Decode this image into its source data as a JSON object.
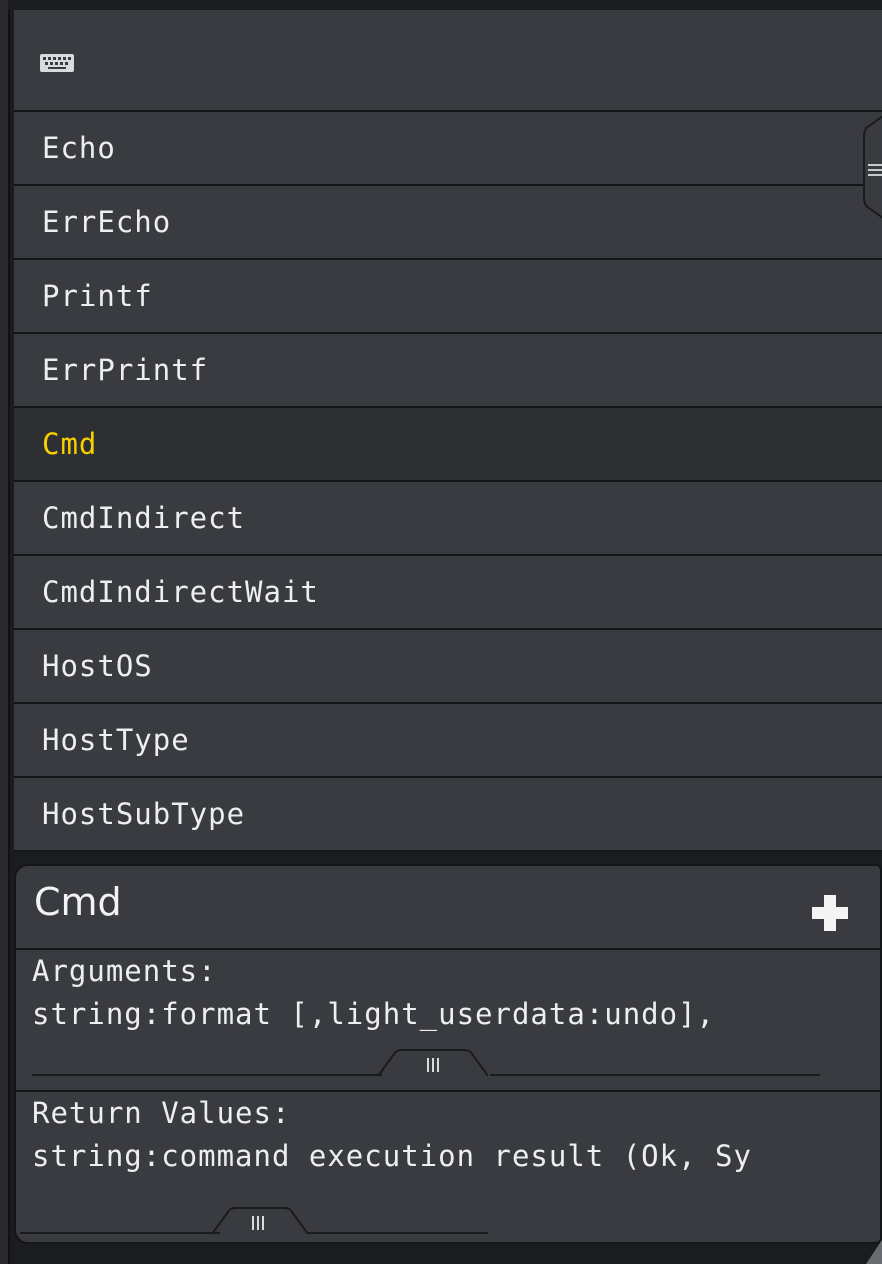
{
  "toolbar": {
    "icon": "keyboard-icon"
  },
  "list": {
    "items": [
      {
        "label": "Echo"
      },
      {
        "label": "ErrEcho"
      },
      {
        "label": "Printf"
      },
      {
        "label": "ErrPrintf"
      },
      {
        "label": "Cmd",
        "selected": true
      },
      {
        "label": "CmdIndirect"
      },
      {
        "label": "CmdIndirectWait"
      },
      {
        "label": "HostOS"
      },
      {
        "label": "HostType"
      },
      {
        "label": "HostSubType"
      }
    ]
  },
  "detail": {
    "title": "Cmd",
    "add_icon": "plus-icon",
    "arguments_heading": "Arguments:",
    "arguments_value": "string:format [,light_userdata:undo],",
    "returns_heading": "Return Values:",
    "returns_value": "string:command execution result (Ok, Sy"
  },
  "colors": {
    "panel": "#3a3b40",
    "selected_text": "#f6d000",
    "text": "#eceef0",
    "background": "#1b1c1f"
  }
}
